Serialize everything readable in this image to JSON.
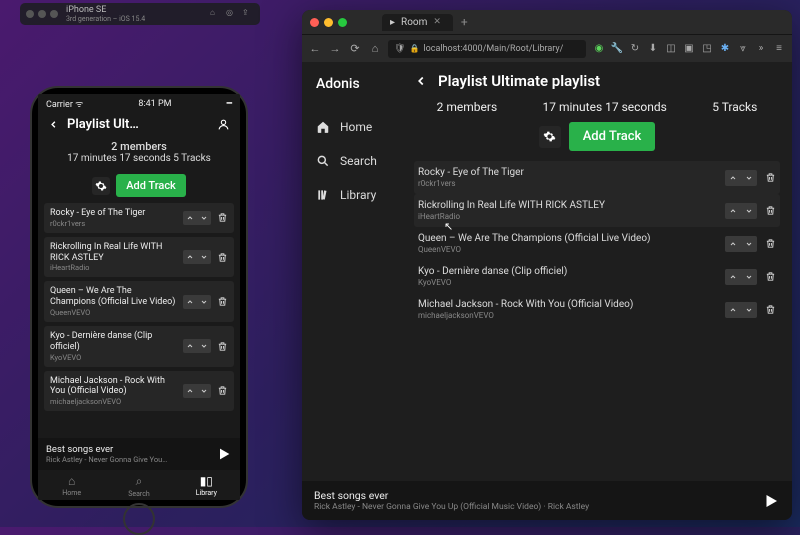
{
  "simulator": {
    "device": "iPhone SE",
    "subtitle": "3rd generation – iOS 15.4"
  },
  "phone": {
    "status": {
      "carrier": "Carrier ᯤ",
      "time": "8:41 PM",
      "battery": "━"
    },
    "header_title": "Playlist Ult…",
    "stats_line1": "2 members",
    "stats_line2": "17 minutes 17 seconds 5 Tracks",
    "add_label": "Add Track",
    "tracks": [
      {
        "title": "Rocky - Eye of The Tiger",
        "sub": "r0ckr1vers"
      },
      {
        "title": "Rickrolling In Real Life WITH RICK ASTLEY",
        "sub": "iHeartRadio"
      },
      {
        "title": "Queen – We Are The Champions (Official Live Video)",
        "sub": "QueenVEVO"
      },
      {
        "title": "Kyo - Dernière danse (Clip officiel)",
        "sub": "KyoVEVO"
      },
      {
        "title": "Michael Jackson - Rock With You (Official Video)",
        "sub": "michaeljacksonVEVO"
      }
    ],
    "now_playing": {
      "title": "Best songs ever",
      "sub": "Rick Astley - Never Gonna Give You…"
    },
    "tabs": {
      "home": "Home",
      "search": "Search",
      "library": "Library"
    }
  },
  "browser": {
    "tab_title": "Room",
    "url_display": "localhost:4000/Main/Root/Library/",
    "brand": "Adonis",
    "nav": {
      "home": "Home",
      "search": "Search",
      "library": "Library"
    },
    "playlist_title": "Playlist Ultimate playlist",
    "stats": {
      "members": "2 members",
      "duration": "17 minutes 17 seconds",
      "tracks": "5 Tracks"
    },
    "add_label": "Add Track",
    "tracks": [
      {
        "title": "Rocky - Eye of The Tiger",
        "sub": "r0ckr1vers",
        "hi": true
      },
      {
        "title": "Rickrolling In Real Life WITH RICK ASTLEY",
        "sub": "iHeartRadio",
        "hi": true
      },
      {
        "title": "Queen – We Are The Champions (Official Live Video)",
        "sub": "QueenVEVO",
        "hi": false
      },
      {
        "title": "Kyo - Dernière danse (Clip officiel)",
        "sub": "KyoVEVO",
        "hi": false
      },
      {
        "title": "Michael Jackson - Rock With You (Official Video)",
        "sub": "michaeljacksonVEVO",
        "hi": false
      }
    ],
    "now_playing": {
      "title": "Best songs ever",
      "sub": "Rick Astley - Never Gonna Give You Up (Official Music Video) · Rick Astley"
    }
  }
}
